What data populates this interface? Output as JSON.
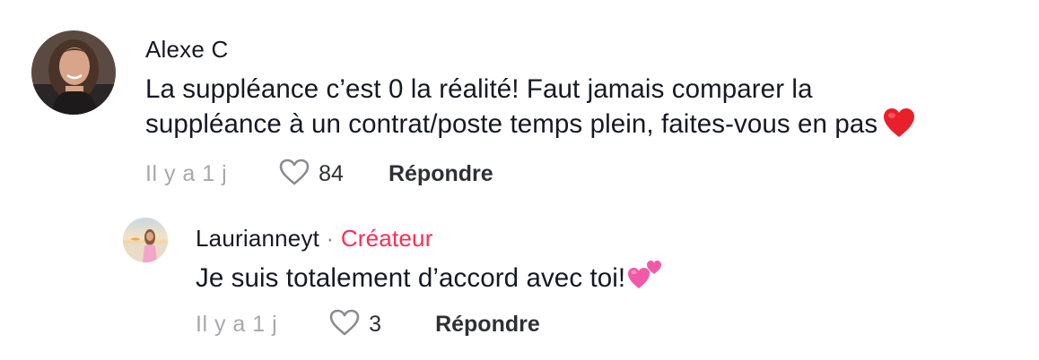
{
  "comments": [
    {
      "username": "Alexe C",
      "text_line1": "La suppléance c’est 0 la réalité! Faut jamais comparer la",
      "text_line2": "suppléance à un contrat/poste temps plein, faites-vous en pas",
      "emoji": "red-heart",
      "time": "Il y a 1 j",
      "likes": "84",
      "reply_label": "Répondre"
    },
    {
      "username": "Laurianneyt",
      "separator": "·",
      "badge": "Créateur",
      "text": "Je suis totalement d’accord avec toi!",
      "emoji": "two-hearts",
      "time": "Il y a 1 j",
      "likes": "3",
      "reply_label": "Répondre"
    }
  ],
  "colors": {
    "text": "#161823",
    "secondary": "#a7a8ad",
    "creator_badge": "#fe2c55",
    "heart_emoji": "#e8202a",
    "two_hearts": "#f25aa8"
  }
}
